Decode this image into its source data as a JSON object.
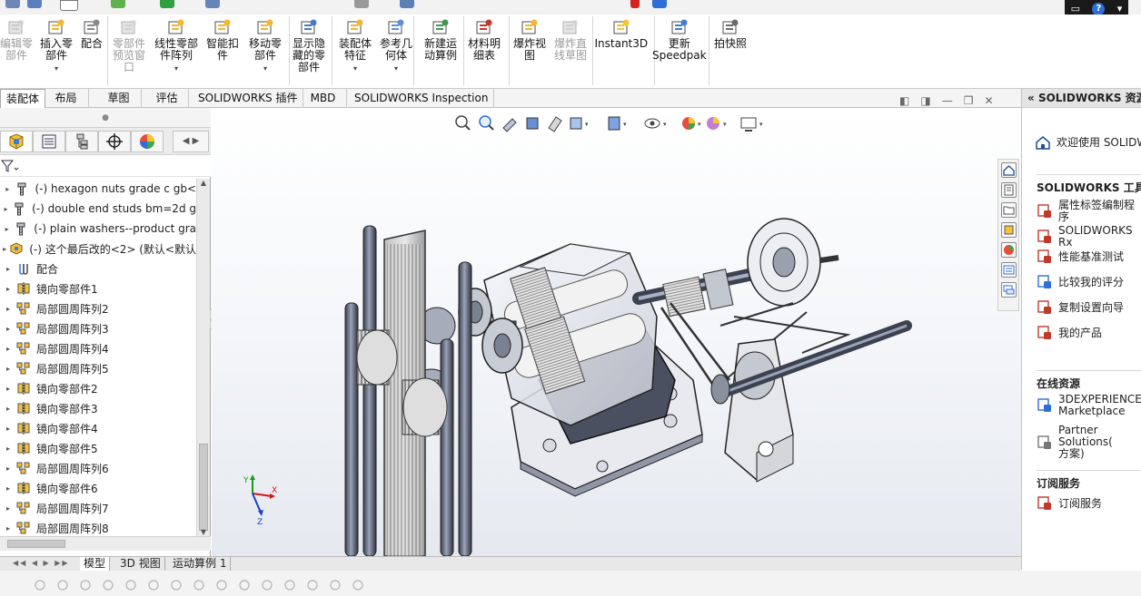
{
  "ribbon": {
    "buttons": [
      {
        "id": "edit-component",
        "label": "编辑零\n部件",
        "disabled": true
      },
      {
        "id": "insert-component",
        "label": "插入零\n部件",
        "disabled": false,
        "dropdown": true
      },
      {
        "id": "mate",
        "label": "配合",
        "disabled": false
      },
      {
        "id": "component-preview",
        "label": "零部件\n预览窗\n口",
        "disabled": true
      },
      {
        "id": "linear-pattern",
        "label": "线性零部\n件阵列",
        "disabled": false,
        "dropdown": true
      },
      {
        "id": "smart-fasteners",
        "label": "智能扣\n件",
        "disabled": false
      },
      {
        "id": "move-component",
        "label": "移动零\n部件",
        "disabled": false,
        "dropdown": true
      },
      {
        "id": "show-hidden",
        "label": "显示隐\n藏的零\n部件",
        "disabled": false
      },
      {
        "id": "assembly-features",
        "label": "装配体\n特征",
        "disabled": false,
        "dropdown": true
      },
      {
        "id": "reference-geometry",
        "label": "参考几\n何体",
        "disabled": false,
        "dropdown": true
      },
      {
        "id": "new-motion-study",
        "label": "新建运\n动算例",
        "disabled": false
      },
      {
        "id": "bill-of-materials",
        "label": "材料明\n细表",
        "disabled": false
      },
      {
        "id": "exploded-view",
        "label": "爆炸视\n图",
        "disabled": false
      },
      {
        "id": "explode-line-sketch",
        "label": "爆炸直\n线草图",
        "disabled": true
      },
      {
        "id": "instant3d",
        "label": "Instant3D",
        "disabled": false
      },
      {
        "id": "update-speedpak",
        "label": "更新\nSpeedpak",
        "disabled": false
      },
      {
        "id": "take-snapshot",
        "label": "拍快照",
        "disabled": false
      }
    ]
  },
  "tabs": [
    "装配体",
    "布局",
    "草图",
    "评估",
    "SOLIDWORKS 插件",
    "MBD",
    "SOLIDWORKS Inspection"
  ],
  "active_tab": "装配体",
  "feature_tree": [
    {
      "label": "(-) hexagon nuts grade c gb<",
      "icon": "bolt"
    },
    {
      "label": "(-) double end studs bm=2d g",
      "icon": "bolt"
    },
    {
      "label": "(-) plain washers--product gra",
      "icon": "bolt"
    },
    {
      "label": "(-) 这个最后改的<2> (默认<默认",
      "icon": "part"
    },
    {
      "label": "配合",
      "icon": "mate"
    },
    {
      "label": "镜向零部件1",
      "icon": "mirror"
    },
    {
      "label": "局部圆周阵列2",
      "icon": "pattern"
    },
    {
      "label": "局部圆周阵列3",
      "icon": "pattern"
    },
    {
      "label": "局部圆周阵列4",
      "icon": "pattern"
    },
    {
      "label": "局部圆周阵列5",
      "icon": "pattern"
    },
    {
      "label": "镜向零部件2",
      "icon": "mirror"
    },
    {
      "label": "镜向零部件3",
      "icon": "mirror"
    },
    {
      "label": "镜向零部件4",
      "icon": "mirror"
    },
    {
      "label": "镜向零部件5",
      "icon": "mirror"
    },
    {
      "label": "局部圆周阵列6",
      "icon": "pattern"
    },
    {
      "label": "镜向零部件6",
      "icon": "mirror"
    },
    {
      "label": "局部圆周阵列7",
      "icon": "pattern"
    },
    {
      "label": "局部圆周阵列8",
      "icon": "pattern"
    }
  ],
  "bottom_tabs": [
    "模型",
    "3D 视图",
    "运动算例 1"
  ],
  "active_bottom_tab": "模型",
  "task_pane": {
    "header": "SOLIDWORKS 资源",
    "welcome": "欢迎使用  SOLIDW",
    "sections": [
      {
        "title": "SOLIDWORKS 工具",
        "items": [
          "属性标签编制程序",
          "SOLIDWORKS Rx",
          "性能基准测试",
          "比较我的评分",
          "复制设置向导",
          "我的产品"
        ]
      },
      {
        "title": "在线资源",
        "items": [
          "3DEXPERIENCE\nMarketplace",
          "Partner Solutions(\n方案)"
        ]
      },
      {
        "title": "订阅服务",
        "items": [
          "订阅服务"
        ]
      }
    ]
  },
  "triad": {
    "x": "X",
    "y": "Y",
    "z": "Z"
  },
  "colors": {
    "accent": "#2d6fd6",
    "ribbon_bg": "#ffffff",
    "viewport_top": "#ffffff",
    "viewport_bottom": "#e5e9ef"
  }
}
